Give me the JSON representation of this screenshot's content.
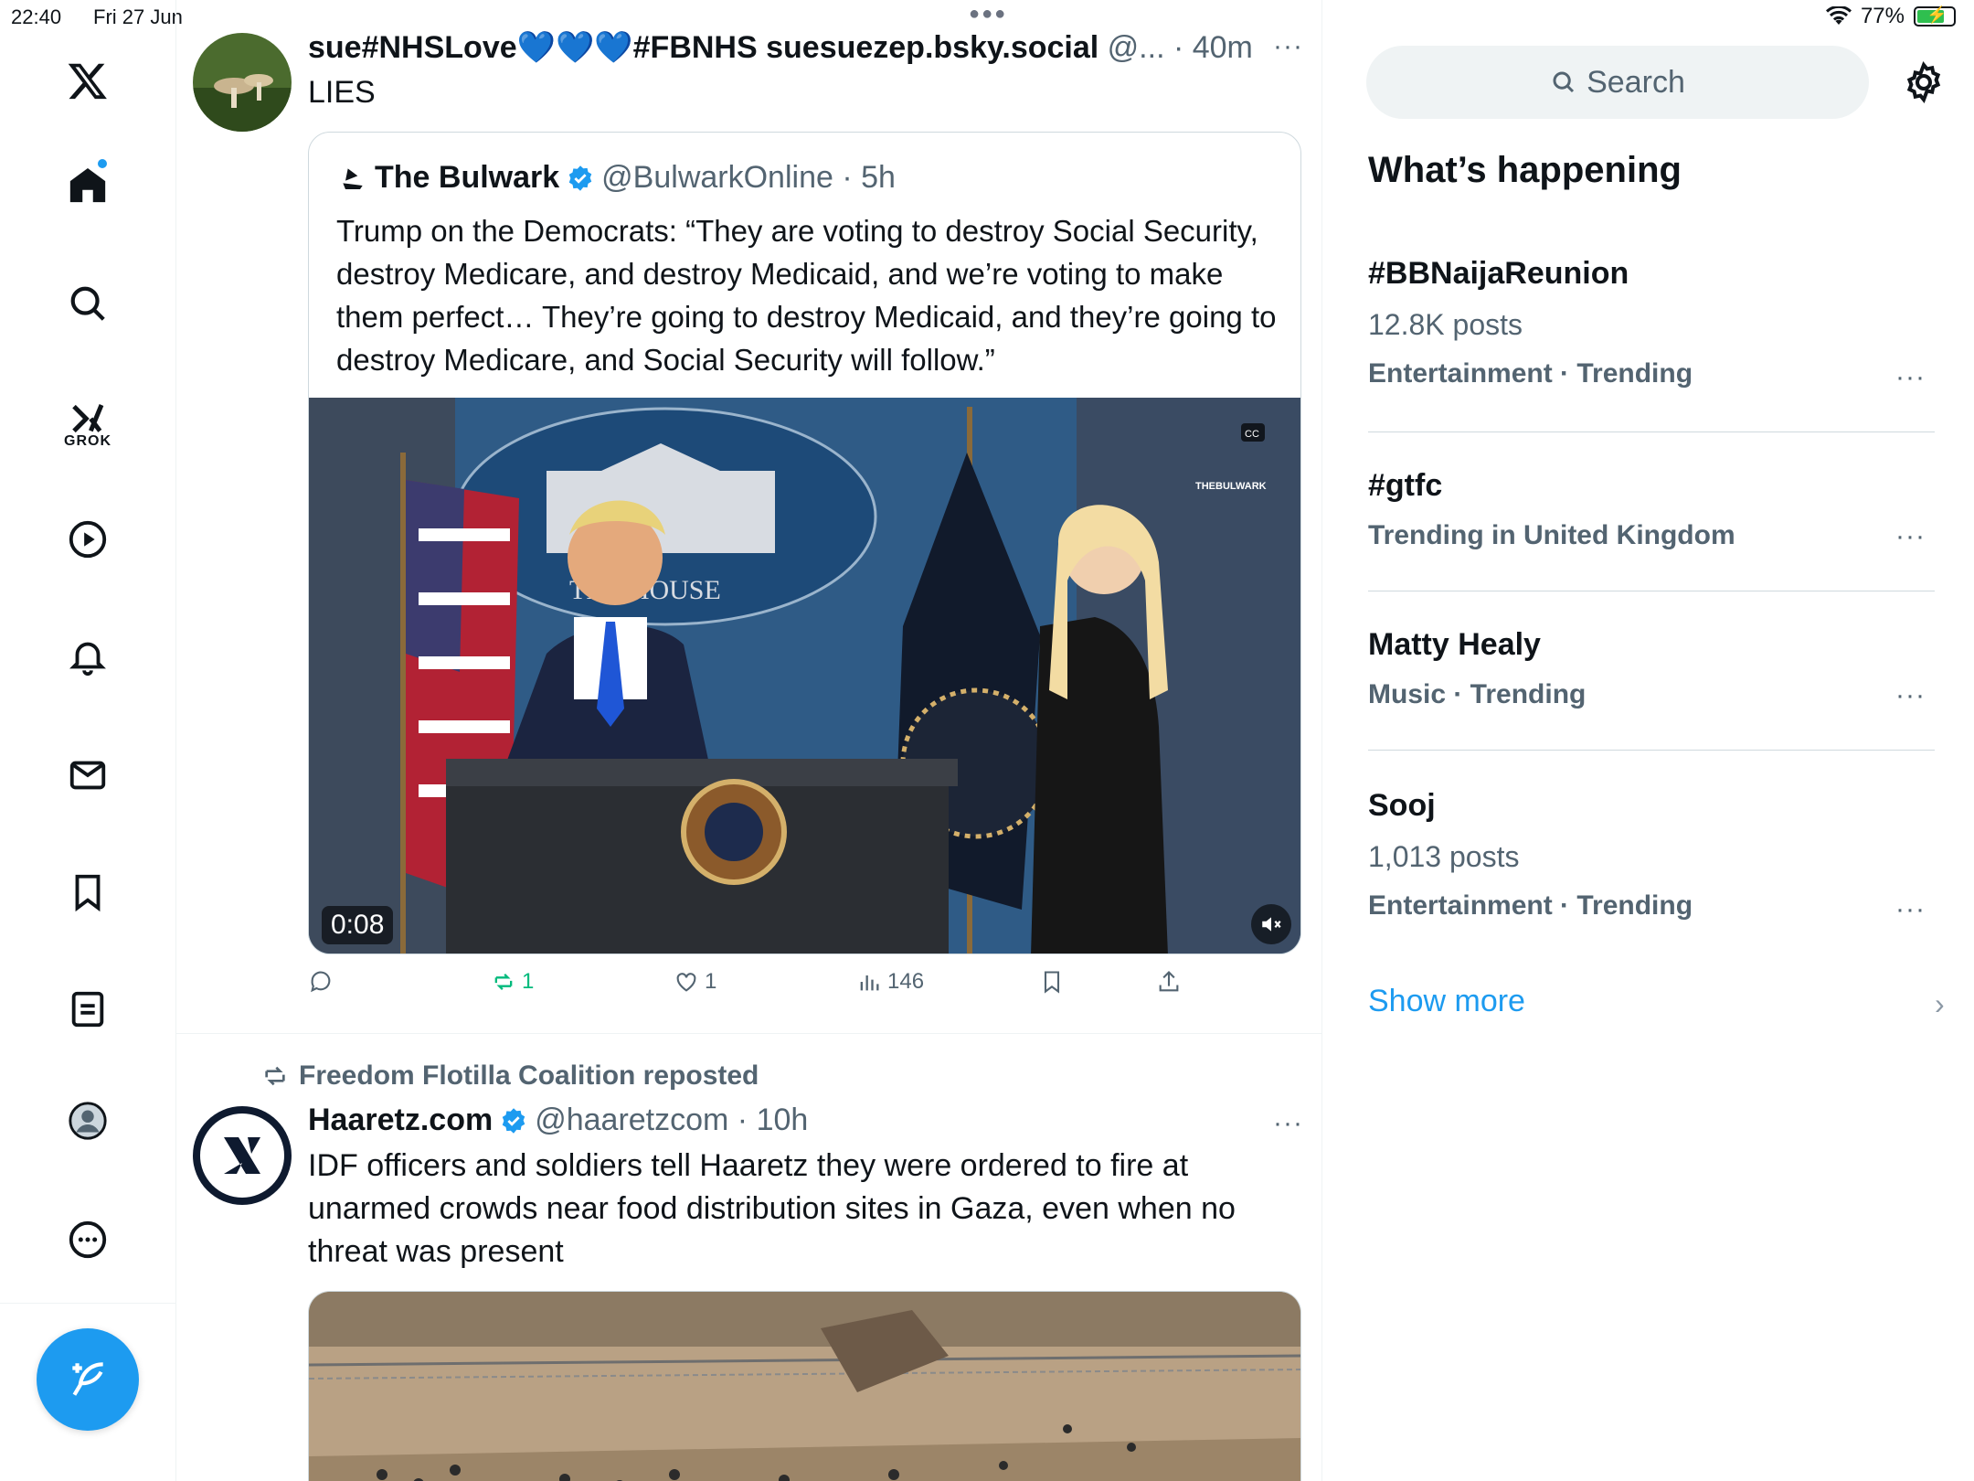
{
  "status_bar": {
    "time": "22:40",
    "date": "Fri 27 Jun",
    "battery": "77%",
    "battery_level": 0.77
  },
  "nav": {
    "items": [
      "x-logo",
      "home",
      "explore",
      "grok",
      "video",
      "notifications",
      "messages",
      "bookmarks",
      "lists",
      "profile",
      "more"
    ],
    "grok_label": "GROK"
  },
  "post1": {
    "author": "sue#NHSLove💙💙💙#FBNHS suesuezep.bsky.social",
    "handle_time": "@... · 40m",
    "more": "···",
    "text": "LIES",
    "quote": {
      "author": "The Bulwark",
      "handle_time": "@BulwarkOnline · 5h",
      "text": "Trump on the Democrats: “They are voting to destroy Social Security, destroy Medicare, and destroy Medicaid, and we’re voting to make them perfect… They’re going to destroy Medicaid, and they’re going to destroy Medicare, and Social Security will follow.”",
      "video_time": "0:08",
      "watermark": "THEBULWARK",
      "cc": "CC",
      "seal_text": "THE  HOUSE"
    },
    "actions": {
      "reposts": "1",
      "likes": "1",
      "views": "146"
    }
  },
  "post2": {
    "repost_by": "Freedom Flotilla Coalition reposted",
    "author": "Haaretz.com",
    "handle_time": "@haaretzcom · 10h",
    "more": "···",
    "text": "IDF officers and soldiers tell Haaretz they were ordered to fire at unarmed crowds near food distribution sites in Gaza, even when no threat was present"
  },
  "right": {
    "search_placeholder": "Search",
    "section_title": "What’s happening",
    "trends": [
      {
        "name": "#BBNaijaReunion",
        "posts": "12.8K posts",
        "category": "Entertainment · Trending"
      },
      {
        "name": "#gtfc",
        "posts": "",
        "category": "Trending in United Kingdom"
      },
      {
        "name": "Matty Healy",
        "posts": "",
        "category": "Music · Trending"
      },
      {
        "name": "Sooj",
        "posts": "1,013 posts",
        "category": "Entertainment · Trending"
      }
    ],
    "more_label": "···",
    "show_more": "Show more"
  },
  "colors": {
    "accent": "#1d9bf0",
    "text": "#0f1419",
    "muted": "#536471",
    "repost_green": "#00ba7c"
  }
}
